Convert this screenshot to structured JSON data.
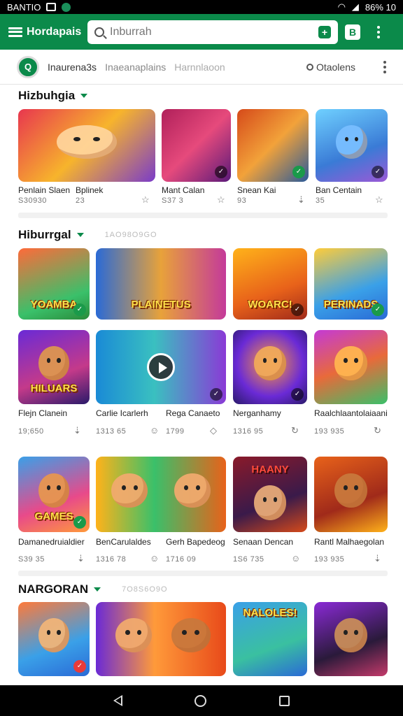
{
  "status_bar": {
    "left_text": "BANTIO",
    "right_text": "86% 10"
  },
  "app_bar": {
    "brand": "Hordapais",
    "search_placeholder": "Inburrah"
  },
  "sub_bar": {
    "logo_text": "Q",
    "tabs": [
      "Inaurena3s",
      "Inaeanaplains",
      "Harnnlaoon"
    ],
    "location_label": "Otaolens"
  },
  "sections": [
    {
      "title": "Hizbuhgia",
      "subtitle": ""
    },
    {
      "title": "Hiburrgal",
      "subtitle": "1AO98O9GO"
    },
    {
      "title": "NARGORAN",
      "subtitle": "7O8S6O9O"
    }
  ],
  "row1": [
    {
      "title": "Penlain Slaen",
      "meta": "S30930"
    },
    {
      "title": "Bplinek",
      "meta": "23"
    },
    {
      "title": "Mant Calan",
      "meta": "S37 3"
    },
    {
      "title": "Snean Kai",
      "meta": "93"
    },
    {
      "title": "Ban Centain",
      "meta": "35"
    }
  ],
  "row2_tiles": [
    {
      "word": "YOAMBA"
    },
    {
      "word": "PLAINETUS"
    },
    {
      "word": "WOARC!"
    },
    {
      "word": "PERINADS"
    }
  ],
  "row3": [
    {
      "word": "HILUARS",
      "title": "Flejn Clanein",
      "meta": "19;650"
    },
    {
      "word": "",
      "title": "Carlie Icarlerh",
      "meta": "1313 65"
    },
    {
      "word": "",
      "title": "Rega Canaeto",
      "meta": "1799"
    },
    {
      "word": "",
      "title": "Nerganhamy",
      "meta": "1316 95"
    },
    {
      "word": "",
      "title": "Raalchlaantolaiaani",
      "meta": "193 935"
    }
  ],
  "row4": [
    {
      "word": "GAMES",
      "title": "Damanedruialdier",
      "meta": "S39 35"
    },
    {
      "word": "",
      "title": "BenCarulaldes",
      "meta": "1316 78"
    },
    {
      "word": "",
      "title": "Gerh Bapedeog",
      "meta": "1716 09"
    },
    {
      "word": "HAANY",
      "title": "Senaan Dencan",
      "meta": "1S6 735"
    },
    {
      "word": "",
      "title": "Rantl Malhaegolan",
      "meta": "193 935"
    }
  ],
  "row5_tiles": [
    {
      "word": ""
    },
    {
      "word": ""
    },
    {
      "word": "NALOLES!"
    },
    {
      "word": ""
    }
  ],
  "colors": {
    "brand_green": "#0b8a4a"
  }
}
